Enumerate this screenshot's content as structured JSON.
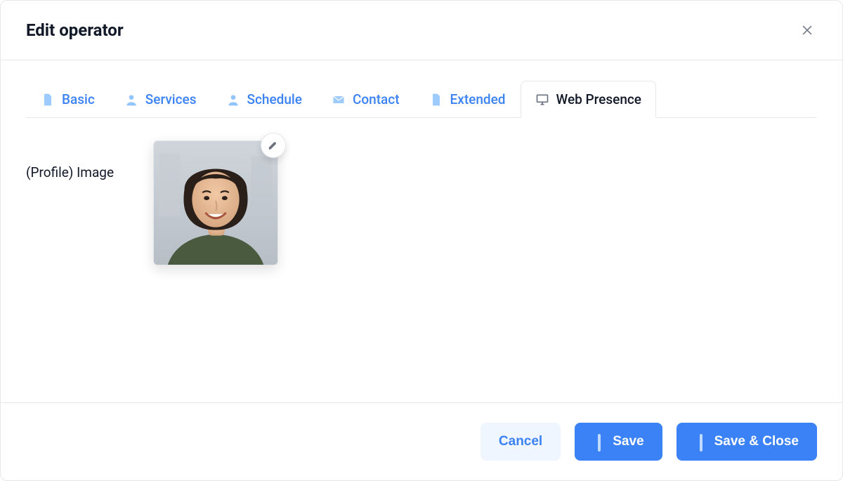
{
  "header": {
    "title": "Edit operator"
  },
  "tabs": [
    {
      "label": "Basic",
      "icon": "file-icon",
      "active": false
    },
    {
      "label": "Services",
      "icon": "person-icon",
      "active": false
    },
    {
      "label": "Schedule",
      "icon": "person-icon",
      "active": false
    },
    {
      "label": "Contact",
      "icon": "mail-icon",
      "active": false
    },
    {
      "label": "Extended",
      "icon": "file-icon",
      "active": false
    },
    {
      "label": "Web Presence",
      "icon": "monitor-icon",
      "active": true
    }
  ],
  "content": {
    "profile_image_label": "(Profile) Image"
  },
  "footer": {
    "cancel_label": "Cancel",
    "save_label": "Save",
    "save_close_label": "Save & Close"
  },
  "colors": {
    "accent": "#3b82f6"
  }
}
